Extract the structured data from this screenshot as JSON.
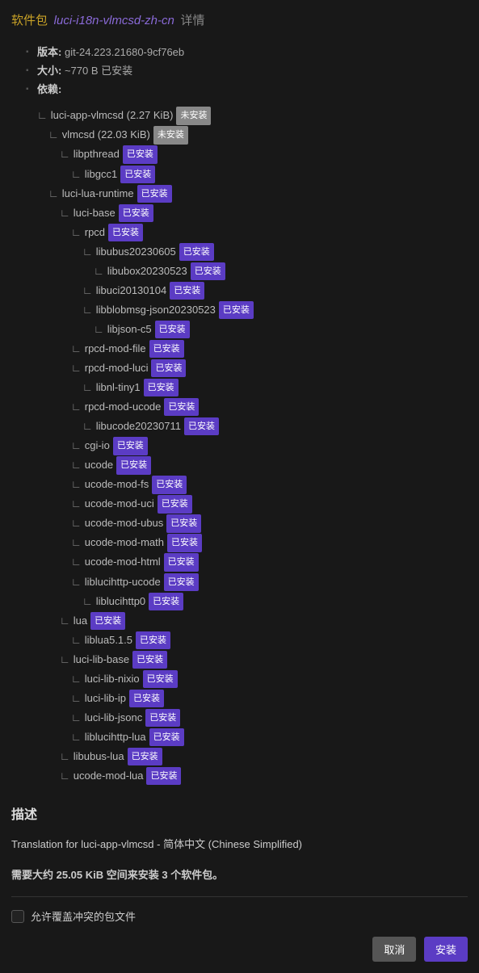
{
  "header": {
    "label": "软件包",
    "name": "luci-i18n-vlmcsd-zh-cn",
    "suffix": "详情"
  },
  "meta": {
    "version_label": "版本:",
    "version_value": "git-24.223.21680-9cf76eb",
    "size_label": "大小:",
    "size_value": "~770 B 已安装",
    "deps_label": "依赖:"
  },
  "status": {
    "installed": "已安装",
    "not_installed": "未安装"
  },
  "deps": [
    {
      "indent": 0,
      "name": "luci-app-vlmcsd",
      "extra": "(2.27 KiB)",
      "status": "not_installed"
    },
    {
      "indent": 1,
      "name": "vlmcsd",
      "extra": "(22.03 KiB)",
      "status": "not_installed"
    },
    {
      "indent": 2,
      "name": "libpthread",
      "status": "installed"
    },
    {
      "indent": 3,
      "name": "libgcc1",
      "status": "installed"
    },
    {
      "indent": 1,
      "name": "luci-lua-runtime",
      "status": "installed"
    },
    {
      "indent": 2,
      "name": "luci-base",
      "status": "installed"
    },
    {
      "indent": 3,
      "name": "rpcd",
      "status": "installed"
    },
    {
      "indent": 4,
      "name": "libubus20230605",
      "status": "installed"
    },
    {
      "indent": 5,
      "name": "libubox20230523",
      "status": "installed"
    },
    {
      "indent": 4,
      "name": "libuci20130104",
      "status": "installed"
    },
    {
      "indent": 4,
      "name": "libblobmsg-json20230523",
      "status": "installed"
    },
    {
      "indent": 5,
      "name": "libjson-c5",
      "status": "installed"
    },
    {
      "indent": 3,
      "name": "rpcd-mod-file",
      "status": "installed"
    },
    {
      "indent": 3,
      "name": "rpcd-mod-luci",
      "status": "installed"
    },
    {
      "indent": 4,
      "name": "libnl-tiny1",
      "status": "installed"
    },
    {
      "indent": 3,
      "name": "rpcd-mod-ucode",
      "status": "installed"
    },
    {
      "indent": 4,
      "name": "libucode20230711",
      "status": "installed"
    },
    {
      "indent": 3,
      "name": "cgi-io",
      "status": "installed"
    },
    {
      "indent": 3,
      "name": "ucode",
      "status": "installed"
    },
    {
      "indent": 3,
      "name": "ucode-mod-fs",
      "status": "installed"
    },
    {
      "indent": 3,
      "name": "ucode-mod-uci",
      "status": "installed"
    },
    {
      "indent": 3,
      "name": "ucode-mod-ubus",
      "status": "installed"
    },
    {
      "indent": 3,
      "name": "ucode-mod-math",
      "status": "installed"
    },
    {
      "indent": 3,
      "name": "ucode-mod-html",
      "status": "installed"
    },
    {
      "indent": 3,
      "name": "liblucihttp-ucode",
      "status": "installed"
    },
    {
      "indent": 4,
      "name": "liblucihttp0",
      "status": "installed"
    },
    {
      "indent": 2,
      "name": "lua",
      "status": "installed"
    },
    {
      "indent": 3,
      "name": "liblua5.1.5",
      "status": "installed"
    },
    {
      "indent": 2,
      "name": "luci-lib-base",
      "status": "installed"
    },
    {
      "indent": 3,
      "name": "luci-lib-nixio",
      "status": "installed"
    },
    {
      "indent": 3,
      "name": "luci-lib-ip",
      "status": "installed"
    },
    {
      "indent": 3,
      "name": "luci-lib-jsonc",
      "status": "installed"
    },
    {
      "indent": 3,
      "name": "liblucihttp-lua",
      "status": "installed"
    },
    {
      "indent": 2,
      "name": "libubus-lua",
      "status": "installed"
    },
    {
      "indent": 2,
      "name": "ucode-mod-lua",
      "status": "installed"
    }
  ],
  "description": {
    "title": "描述",
    "text": "Translation for luci-app-vlmcsd - 简体中文 (Chinese Simplified)"
  },
  "space_text": "需要大约 25.05 KiB 空间来安装 3 个软件包。",
  "overwrite_label": "允许覆盖冲突的包文件",
  "buttons": {
    "cancel": "取消",
    "install": "安装"
  }
}
